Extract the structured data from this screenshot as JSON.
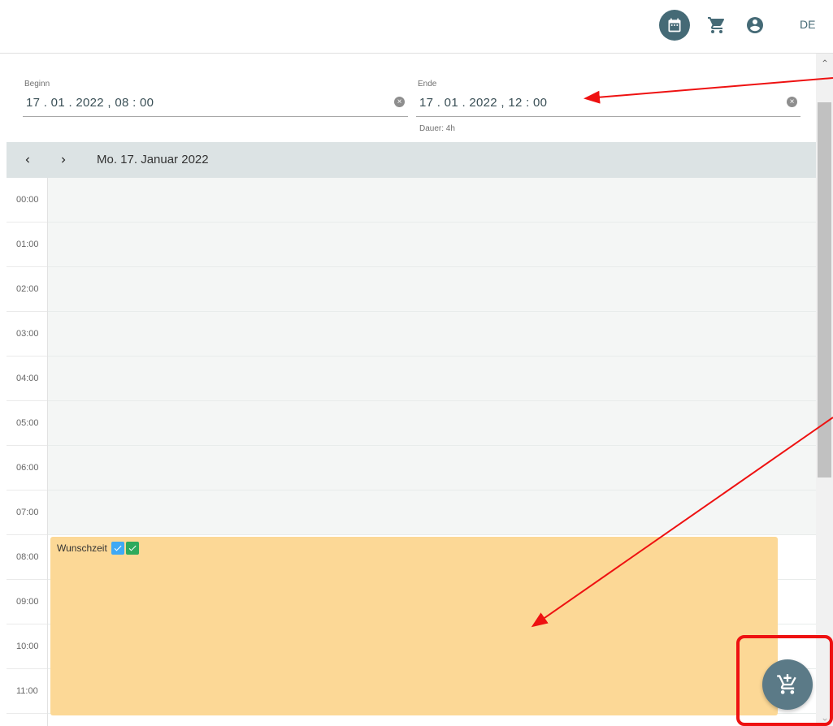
{
  "topbar": {
    "calendar_icon": "calendar-icon",
    "cart_icon": "cart-icon",
    "user_icon": "account-circle-icon",
    "language": "DE",
    "accent_color": "#456a76"
  },
  "begin": {
    "label": "Beginn",
    "value": "17 . 01 . 2022 ,  08 : 00"
  },
  "end": {
    "label": "Ende",
    "value": "17 . 01 . 2022 ,  12 : 00"
  },
  "duration": "Dauer: 4h",
  "calendar": {
    "date": "Mo. 17. Januar 2022",
    "prev_icon": "chevron-left-icon",
    "next_icon": "chevron-right-icon",
    "hours": [
      "00:00",
      "01:00",
      "02:00",
      "03:00",
      "04:00",
      "05:00",
      "06:00",
      "07:00",
      "08:00",
      "09:00",
      "10:00",
      "11:00"
    ]
  },
  "event": {
    "title": "Wunschzeit",
    "color": "#fcd896"
  },
  "fab": {
    "icon": "add-to-cart-icon"
  },
  "annotation_color": "#ee1111"
}
